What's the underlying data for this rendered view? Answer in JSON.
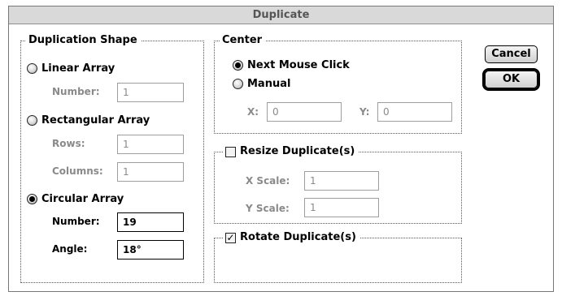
{
  "window": {
    "title": "Duplicate"
  },
  "shape": {
    "legend": "Duplication Shape",
    "linear": {
      "label": "Linear Array",
      "number_label": "Number:",
      "number_value": "1",
      "selected": false
    },
    "rect": {
      "label": "Rectangular Array",
      "rows_label": "Rows:",
      "rows_value": "1",
      "columns_label": "Columns:",
      "columns_value": "1",
      "selected": false
    },
    "circular": {
      "label": "Circular Array",
      "number_label": "Number:",
      "number_value": "19",
      "angle_label": "Angle:",
      "angle_value": "18°",
      "selected": true
    }
  },
  "center": {
    "legend": "Center",
    "next_mouse_click": {
      "label": "Next Mouse Click",
      "selected": true
    },
    "manual": {
      "label": "Manual",
      "selected": false
    },
    "x_label": "X:",
    "x_value": "0",
    "y_label": "Y:",
    "y_value": "0"
  },
  "resize": {
    "label": "Resize Duplicate(s)",
    "checked": false,
    "xscale_label": "X Scale:",
    "xscale_value": "1",
    "yscale_label": "Y Scale:",
    "yscale_value": "1"
  },
  "rotate": {
    "label": "Rotate Duplicate(s)",
    "checked": true,
    "check_glyph": "✓"
  },
  "buttons": {
    "cancel": "Cancel",
    "ok": "OK"
  }
}
